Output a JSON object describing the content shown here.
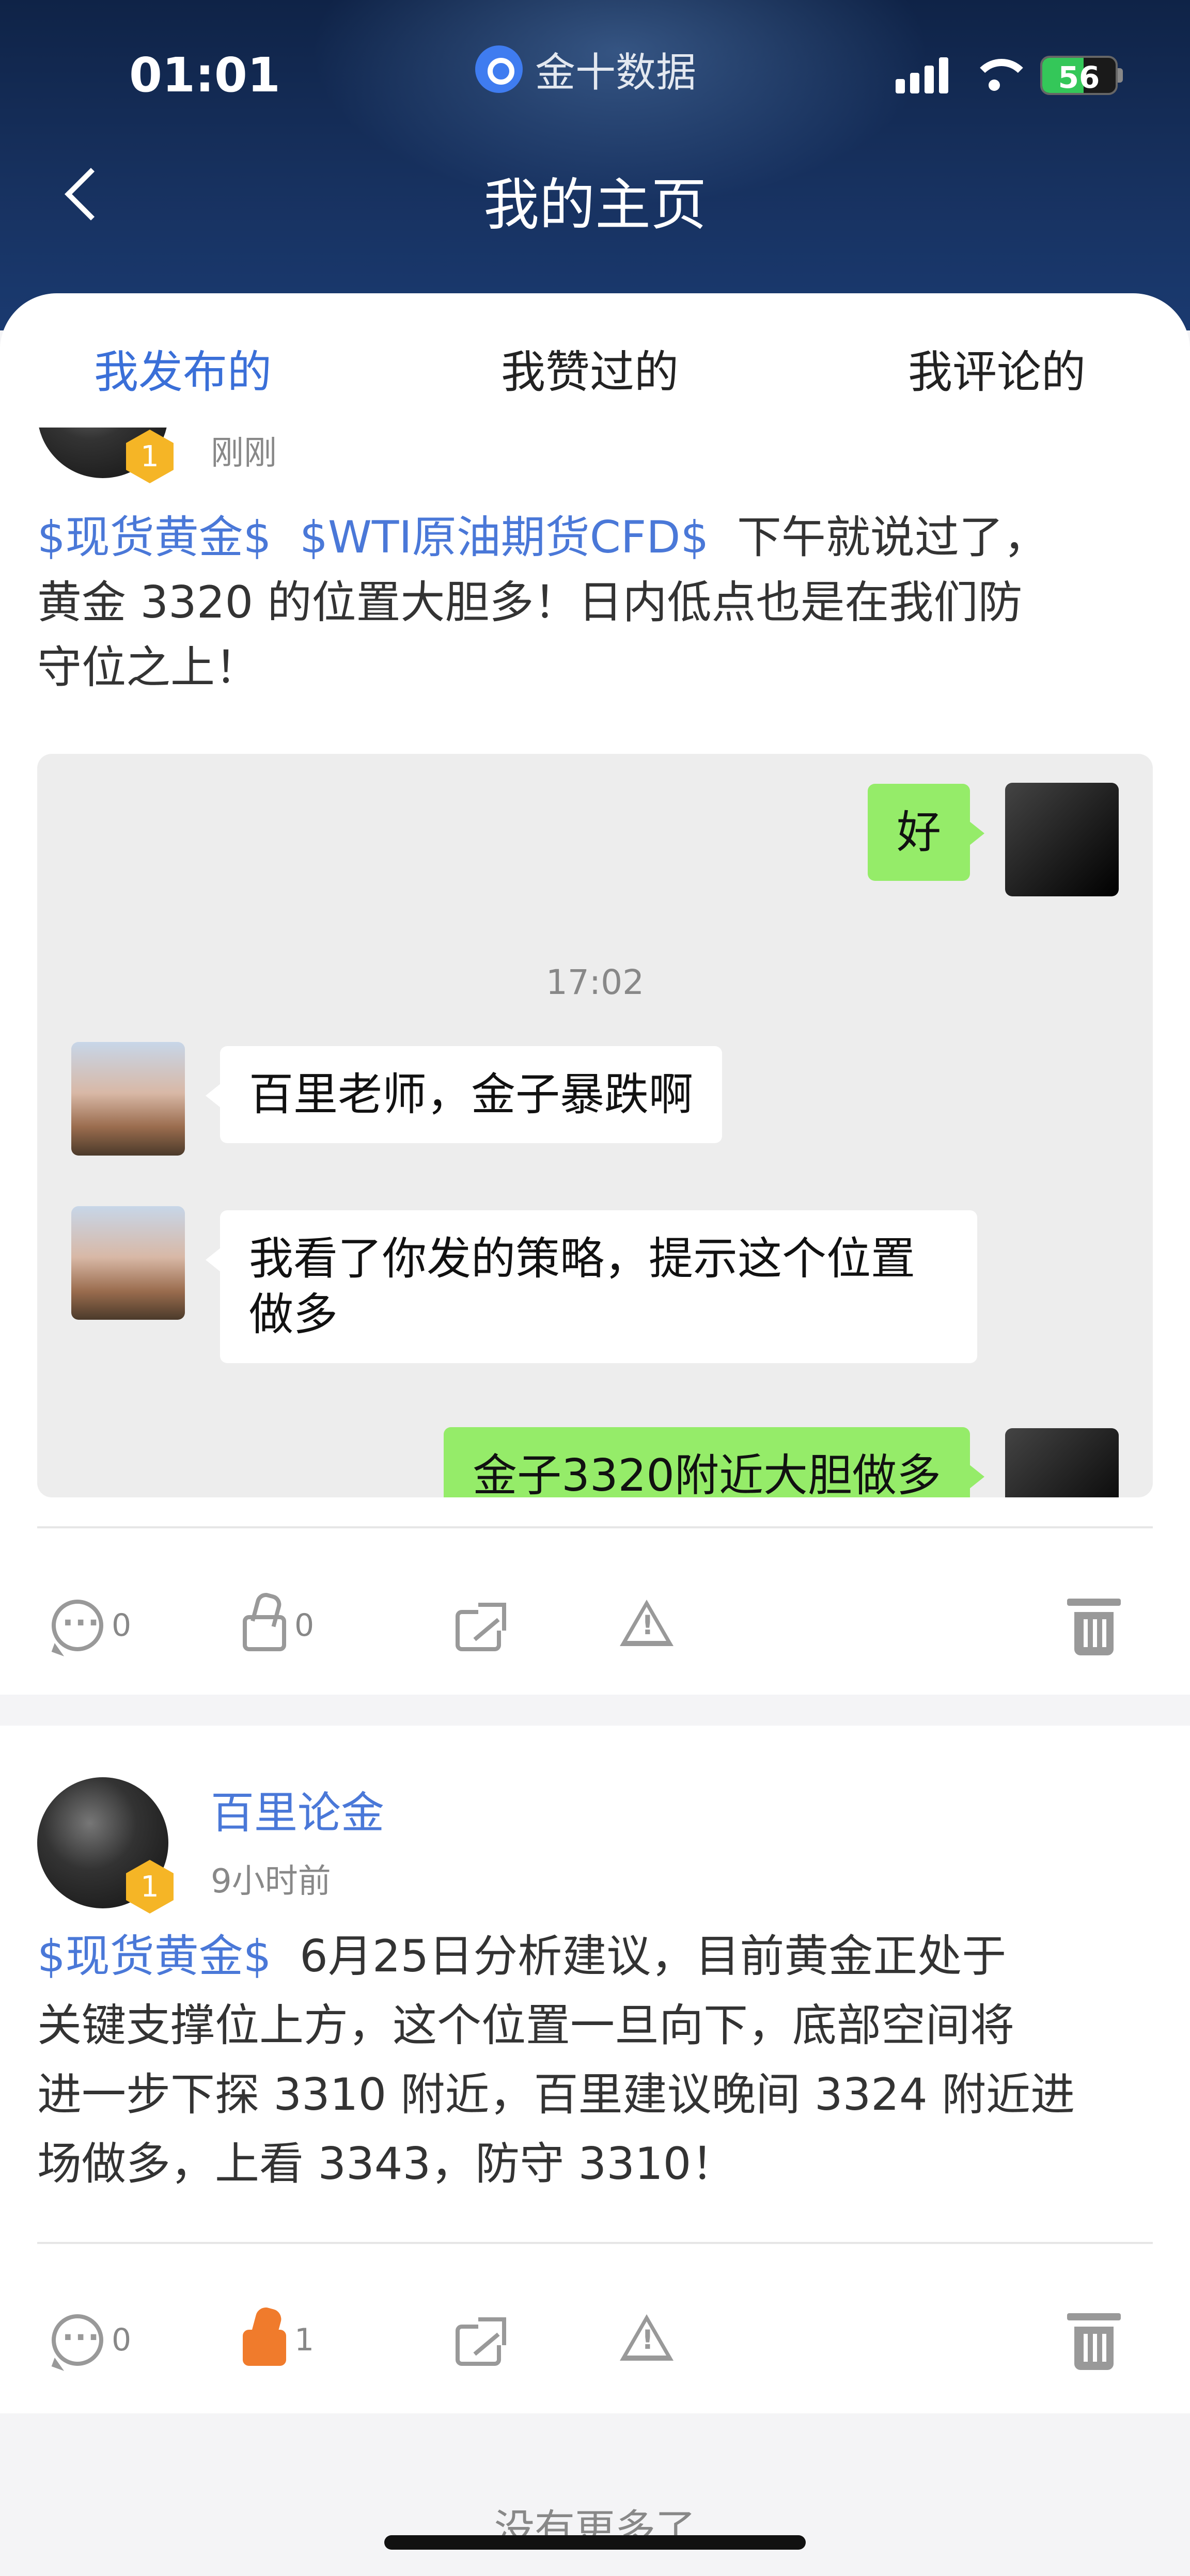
{
  "status_bar": {
    "time": "01:01",
    "app_name": "金十数据",
    "battery": "56"
  },
  "header": {
    "title": "我的主页"
  },
  "tabs": [
    {
      "label": "我发布的",
      "active": true
    },
    {
      "label": "我赞过的",
      "active": false
    },
    {
      "label": "我评论的",
      "active": false
    }
  ],
  "posts": [
    {
      "time": "刚刚",
      "tags": [
        "$现货黄金$",
        "$WTI原油期货CFD$"
      ],
      "text_line1_rest": "下午就说过了，",
      "text_line2": "黄金 3320 的位置大胆多！日内低点也是在我们防",
      "text_line3": "守位之上！",
      "chat": {
        "msg_me_1": "好",
        "time": "17:02",
        "msg_other_1": "百里老师，金子暴跌啊",
        "msg_other_2": "我看了你发的策略，提示这个位置做多",
        "msg_me_2": "金子3320附近大胆做多"
      },
      "comments": "0",
      "likes": "0",
      "liked": false
    },
    {
      "author": "百里论金",
      "time": "9小时前",
      "tag": "$现货黄金$",
      "text_line1_rest": "6月25日分析建议，目前黄金正处于",
      "text_line2": "关键支撑位上方，这个位置一旦向下，底部空间将",
      "text_line3": "进一步下探 3310 附近，百里建议晚间 3324 附近进",
      "text_line4": "场做多，上看 3343，防守 3310！",
      "comments": "0",
      "likes": "1",
      "liked": true
    }
  ],
  "footer": {
    "no_more": "没有更多了"
  },
  "icons": {
    "badge_level": "1",
    "accent_color": "#3a6fd8",
    "like_active_color": "#f07b2c",
    "bubble_me_color": "#95ec69"
  }
}
